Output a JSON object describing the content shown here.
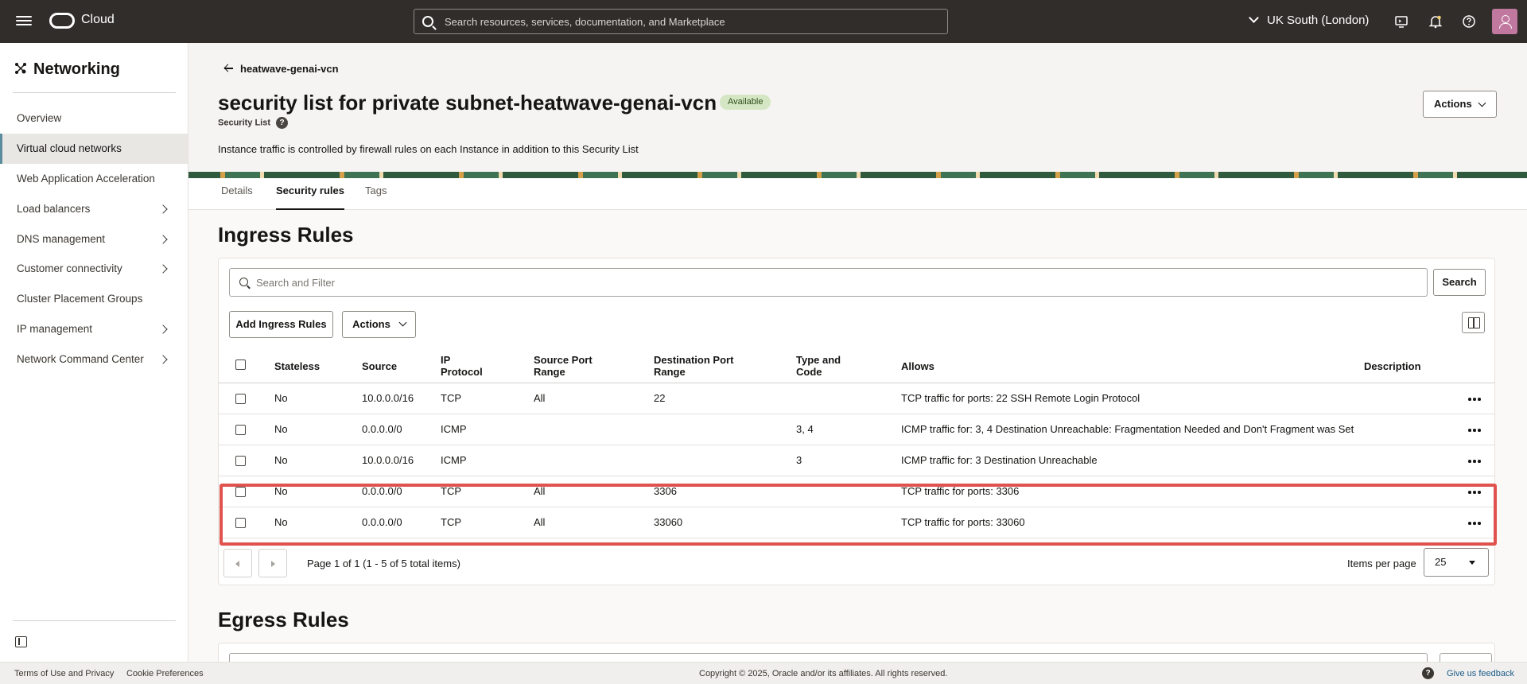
{
  "topbar": {
    "brand": "Cloud",
    "search_placeholder": "Search resources, services, documentation, and Marketplace",
    "region": "UK South (London)"
  },
  "sidebar": {
    "title": "Networking",
    "items": [
      {
        "label": "Overview",
        "has_children": false
      },
      {
        "label": "Virtual cloud networks",
        "has_children": false,
        "active": true
      },
      {
        "label": "Web Application Acceleration",
        "has_children": false
      },
      {
        "label": "Load balancers",
        "has_children": true
      },
      {
        "label": "DNS management",
        "has_children": true
      },
      {
        "label": "Customer connectivity",
        "has_children": true
      },
      {
        "label": "Cluster Placement Groups",
        "has_children": false
      },
      {
        "label": "IP management",
        "has_children": true
      },
      {
        "label": "Network Command Center",
        "has_children": true
      }
    ]
  },
  "header": {
    "back_label": "heatwave-genai-vcn",
    "title": "security list for private subnet-heatwave-genai-vcn",
    "status_badge": "Available",
    "subtitle": "Security List",
    "help_glyph": "?",
    "description": "Instance traffic is controlled by firewall rules on each Instance in addition to this Security List",
    "actions_label": "Actions"
  },
  "tabs": [
    {
      "label": "Details",
      "active": false
    },
    {
      "label": "Security rules",
      "active": true
    },
    {
      "label": "Tags",
      "active": false
    }
  ],
  "ingress": {
    "title": "Ingress Rules",
    "search_placeholder": "Search and Filter",
    "search_button": "Search",
    "add_button": "Add Ingress Rules",
    "actions_button": "Actions",
    "columns": {
      "stateless": "Stateless",
      "source": "Source",
      "ip_protocol": "IP Protocol",
      "source_port_range": "Source Port Range",
      "destination_port_range": "Destination Port Range",
      "type_and_code": "Type and Code",
      "allows": "Allows",
      "description": "Description"
    },
    "rows": [
      {
        "stateless": "No",
        "source": "10.0.0.0/16",
        "protocol": "TCP",
        "src_port": "All",
        "dst_port": "22",
        "type_code": "",
        "allows": "TCP traffic for ports: 22 SSH Remote Login Protocol",
        "description": ""
      },
      {
        "stateless": "No",
        "source": "0.0.0.0/0",
        "protocol": "ICMP",
        "src_port": "",
        "dst_port": "",
        "type_code": "3, 4",
        "allows": "ICMP traffic for: 3, 4 Destination Unreachable: Fragmentation Needed and Don't Fragment was Set",
        "description": ""
      },
      {
        "stateless": "No",
        "source": "10.0.0.0/16",
        "protocol": "ICMP",
        "src_port": "",
        "dst_port": "",
        "type_code": "3",
        "allows": "ICMP traffic for: 3 Destination Unreachable",
        "description": ""
      },
      {
        "stateless": "No",
        "source": "0.0.0.0/0",
        "protocol": "TCP",
        "src_port": "All",
        "dst_port": "3306",
        "type_code": "",
        "allows": "TCP traffic for ports: 3306",
        "description": ""
      },
      {
        "stateless": "No",
        "source": "0.0.0.0/0",
        "protocol": "TCP",
        "src_port": "All",
        "dst_port": "33060",
        "type_code": "",
        "allows": "TCP traffic for ports: 33060",
        "description": ""
      }
    ],
    "pagination": {
      "page_info": "Page 1 of 1 (1 - 5 of 5 total items)",
      "items_per_page_label": "Items per page",
      "items_per_page": "25"
    }
  },
  "egress": {
    "title": "Egress Rules"
  },
  "footer": {
    "terms": "Terms of Use and Privacy",
    "cookies": "Cookie Preferences",
    "copyright": "Copyright © 2025, Oracle and/or its affiliates. All rights reserved.",
    "help_glyph": "?",
    "feedback": "Give us feedback"
  },
  "colors": {
    "topbar_bg": "#312d2a",
    "highlight_border": "#e0524d",
    "badge_bg": "#d4e6c3",
    "active_nav_accent": "#5b8c9e"
  }
}
